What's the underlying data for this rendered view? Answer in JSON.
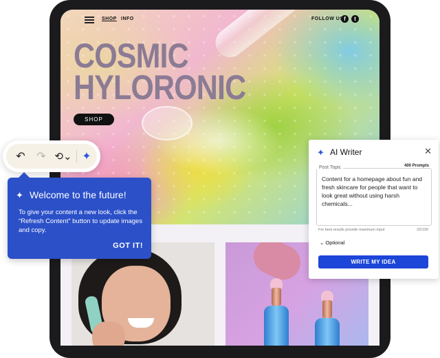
{
  "site": {
    "nav": {
      "shop": "SHOP",
      "info": "INFO",
      "follow": "FOLLOW US",
      "facebook": "f",
      "twitter": "t"
    },
    "hero": {
      "title_line1": "COSMIC",
      "title_line2": "HYLORONIC",
      "shop_button": "SHOP"
    }
  },
  "toolbar": {
    "undo_icon": "↶",
    "redo_icon": "↷",
    "history_icon": "⟲⌄",
    "ai_icon": "✦"
  },
  "welcome": {
    "icon": "✦",
    "title": "Welcome to the future!",
    "body": "To give your content a new look, click the “Refresh Content” button to update images and copy.",
    "button": "GOT IT!"
  },
  "ai_writer": {
    "icon": "✦",
    "title": "AI Writer",
    "close": "✕",
    "prompt_count": "400 Prompts",
    "field_label": "Post Topic",
    "field_value": "Content for a homepage about fun and fresh skincare for people that want to look great without using harsh chemicals...",
    "hint": "For best results provide maximum input",
    "char_count": "32/100",
    "optional": "⌄ Optional",
    "button": "WRITE MY IDEA"
  },
  "colors": {
    "accent_blue": "#2b50c8",
    "button_blue": "#1c46d8",
    "title_mauve": "#8c7b94"
  }
}
